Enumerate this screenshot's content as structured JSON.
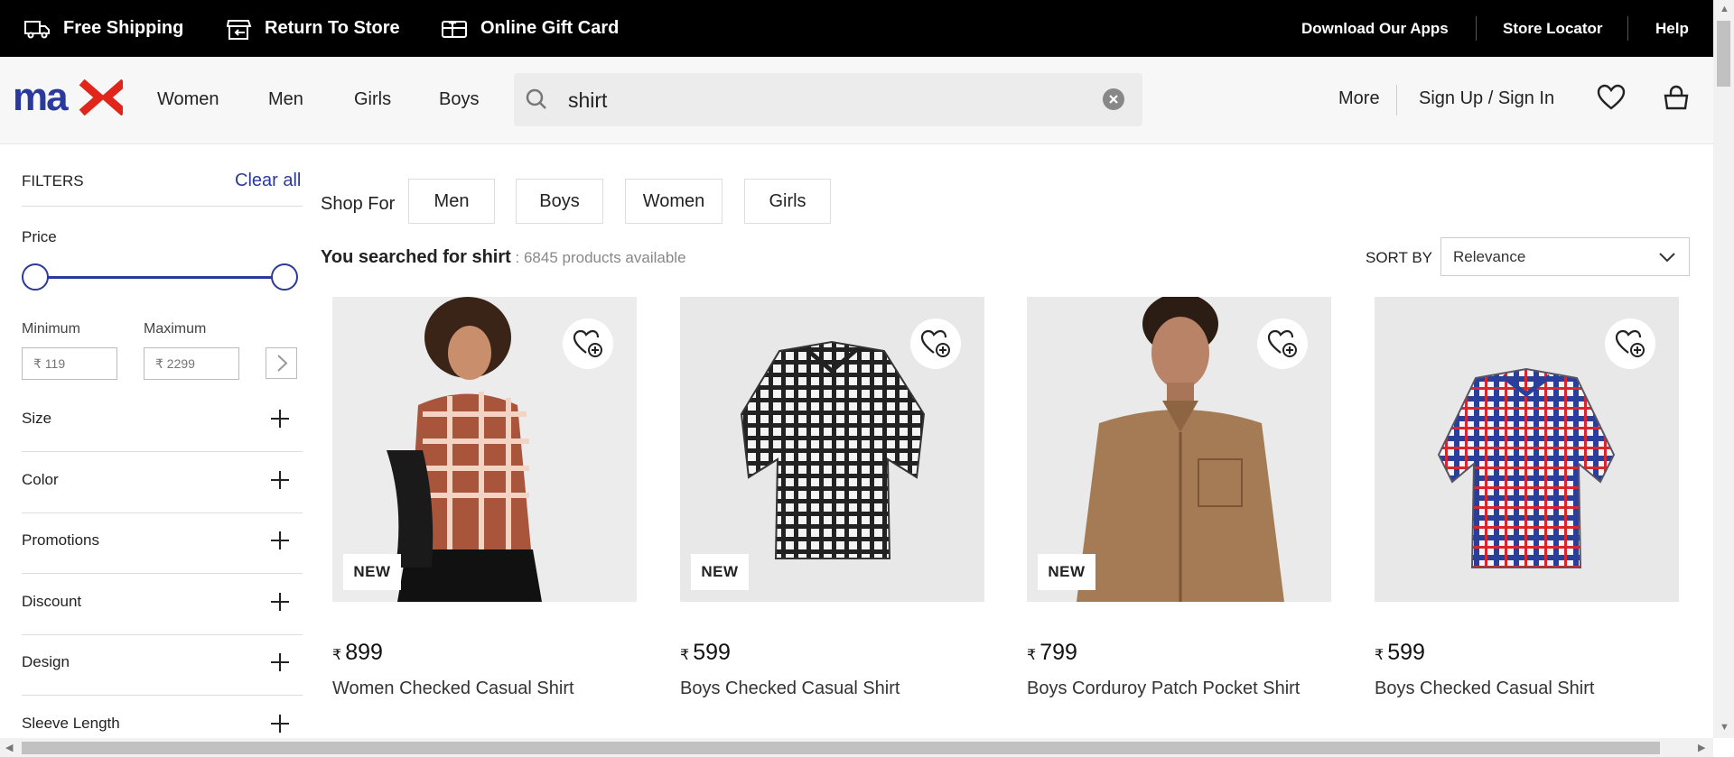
{
  "topbar": {
    "free_shipping": "Free Shipping",
    "return_to_store": "Return To Store",
    "online_gift_card": "Online Gift Card",
    "download_apps": "Download Our Apps",
    "store_locator": "Store Locator",
    "help": "Help"
  },
  "header": {
    "logo": "max",
    "nav": [
      "Women",
      "Men",
      "Girls",
      "Boys"
    ],
    "search_value": "shirt",
    "more": "More",
    "sign_in": "Sign Up / Sign In"
  },
  "filters": {
    "title": "FILTERS",
    "clear_all": "Clear all",
    "price": "Price",
    "minimum_label": "Minimum",
    "maximum_label": "Maximum",
    "minimum_placeholder": "₹ 119",
    "maximum_placeholder": "₹ 2299",
    "sections": [
      "Size",
      "Color",
      "Promotions",
      "Discount",
      "Design",
      "Sleeve Length"
    ]
  },
  "main": {
    "shop_for": "Shop For",
    "chips": [
      "Men",
      "Boys",
      "Women",
      "Girls"
    ],
    "searched_prefix": "You searched for shirt",
    "searched_count": " : 6845 products available",
    "sort_by": "SORT BY",
    "sort_value": "Relevance"
  },
  "products": [
    {
      "badge": "NEW",
      "currency": "₹",
      "price": "899",
      "name": "Women Checked Casual Shirt"
    },
    {
      "badge": "NEW",
      "currency": "₹",
      "price": "599",
      "name": "Boys Checked Casual Shirt"
    },
    {
      "badge": "NEW",
      "currency": "₹",
      "price": "799",
      "name": "Boys Corduroy Patch Pocket Shirt"
    },
    {
      "badge": "",
      "currency": "₹",
      "price": "599",
      "name": "Boys Checked Casual Shirt"
    }
  ],
  "colors": {
    "brand_blue": "#2a3a9c",
    "brand_red": "#e1251b",
    "topbar_bg": "#000000"
  }
}
